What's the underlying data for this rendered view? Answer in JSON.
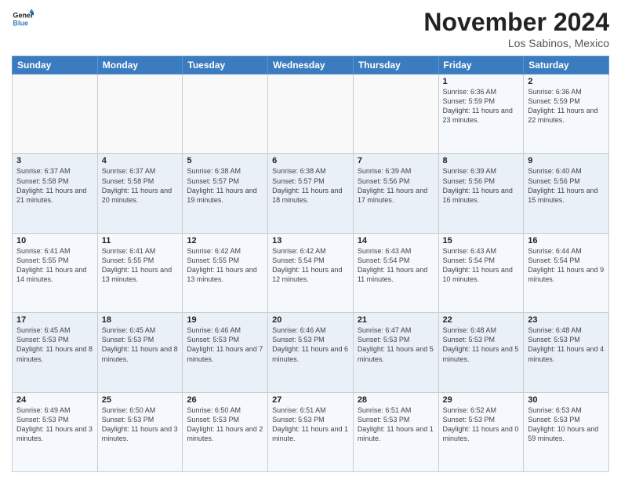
{
  "header": {
    "logo_line1": "General",
    "logo_line2": "Blue",
    "title": "November 2024",
    "location": "Los Sabinos, Mexico"
  },
  "days_of_week": [
    "Sunday",
    "Monday",
    "Tuesday",
    "Wednesday",
    "Thursday",
    "Friday",
    "Saturday"
  ],
  "weeks": [
    [
      {
        "day": "",
        "info": ""
      },
      {
        "day": "",
        "info": ""
      },
      {
        "day": "",
        "info": ""
      },
      {
        "day": "",
        "info": ""
      },
      {
        "day": "",
        "info": ""
      },
      {
        "day": "1",
        "info": "Sunrise: 6:36 AM\nSunset: 5:59 PM\nDaylight: 11 hours and 23 minutes."
      },
      {
        "day": "2",
        "info": "Sunrise: 6:36 AM\nSunset: 5:59 PM\nDaylight: 11 hours and 22 minutes."
      }
    ],
    [
      {
        "day": "3",
        "info": "Sunrise: 6:37 AM\nSunset: 5:58 PM\nDaylight: 11 hours and 21 minutes."
      },
      {
        "day": "4",
        "info": "Sunrise: 6:37 AM\nSunset: 5:58 PM\nDaylight: 11 hours and 20 minutes."
      },
      {
        "day": "5",
        "info": "Sunrise: 6:38 AM\nSunset: 5:57 PM\nDaylight: 11 hours and 19 minutes."
      },
      {
        "day": "6",
        "info": "Sunrise: 6:38 AM\nSunset: 5:57 PM\nDaylight: 11 hours and 18 minutes."
      },
      {
        "day": "7",
        "info": "Sunrise: 6:39 AM\nSunset: 5:56 PM\nDaylight: 11 hours and 17 minutes."
      },
      {
        "day": "8",
        "info": "Sunrise: 6:39 AM\nSunset: 5:56 PM\nDaylight: 11 hours and 16 minutes."
      },
      {
        "day": "9",
        "info": "Sunrise: 6:40 AM\nSunset: 5:56 PM\nDaylight: 11 hours and 15 minutes."
      }
    ],
    [
      {
        "day": "10",
        "info": "Sunrise: 6:41 AM\nSunset: 5:55 PM\nDaylight: 11 hours and 14 minutes."
      },
      {
        "day": "11",
        "info": "Sunrise: 6:41 AM\nSunset: 5:55 PM\nDaylight: 11 hours and 13 minutes."
      },
      {
        "day": "12",
        "info": "Sunrise: 6:42 AM\nSunset: 5:55 PM\nDaylight: 11 hours and 13 minutes."
      },
      {
        "day": "13",
        "info": "Sunrise: 6:42 AM\nSunset: 5:54 PM\nDaylight: 11 hours and 12 minutes."
      },
      {
        "day": "14",
        "info": "Sunrise: 6:43 AM\nSunset: 5:54 PM\nDaylight: 11 hours and 11 minutes."
      },
      {
        "day": "15",
        "info": "Sunrise: 6:43 AM\nSunset: 5:54 PM\nDaylight: 11 hours and 10 minutes."
      },
      {
        "day": "16",
        "info": "Sunrise: 6:44 AM\nSunset: 5:54 PM\nDaylight: 11 hours and 9 minutes."
      }
    ],
    [
      {
        "day": "17",
        "info": "Sunrise: 6:45 AM\nSunset: 5:53 PM\nDaylight: 11 hours and 8 minutes."
      },
      {
        "day": "18",
        "info": "Sunrise: 6:45 AM\nSunset: 5:53 PM\nDaylight: 11 hours and 8 minutes."
      },
      {
        "day": "19",
        "info": "Sunrise: 6:46 AM\nSunset: 5:53 PM\nDaylight: 11 hours and 7 minutes."
      },
      {
        "day": "20",
        "info": "Sunrise: 6:46 AM\nSunset: 5:53 PM\nDaylight: 11 hours and 6 minutes."
      },
      {
        "day": "21",
        "info": "Sunrise: 6:47 AM\nSunset: 5:53 PM\nDaylight: 11 hours and 5 minutes."
      },
      {
        "day": "22",
        "info": "Sunrise: 6:48 AM\nSunset: 5:53 PM\nDaylight: 11 hours and 5 minutes."
      },
      {
        "day": "23",
        "info": "Sunrise: 6:48 AM\nSunset: 5:53 PM\nDaylight: 11 hours and 4 minutes."
      }
    ],
    [
      {
        "day": "24",
        "info": "Sunrise: 6:49 AM\nSunset: 5:53 PM\nDaylight: 11 hours and 3 minutes."
      },
      {
        "day": "25",
        "info": "Sunrise: 6:50 AM\nSunset: 5:53 PM\nDaylight: 11 hours and 3 minutes."
      },
      {
        "day": "26",
        "info": "Sunrise: 6:50 AM\nSunset: 5:53 PM\nDaylight: 11 hours and 2 minutes."
      },
      {
        "day": "27",
        "info": "Sunrise: 6:51 AM\nSunset: 5:53 PM\nDaylight: 11 hours and 1 minute."
      },
      {
        "day": "28",
        "info": "Sunrise: 6:51 AM\nSunset: 5:53 PM\nDaylight: 11 hours and 1 minute."
      },
      {
        "day": "29",
        "info": "Sunrise: 6:52 AM\nSunset: 5:53 PM\nDaylight: 11 hours and 0 minutes."
      },
      {
        "day": "30",
        "info": "Sunrise: 6:53 AM\nSunset: 5:53 PM\nDaylight: 10 hours and 59 minutes."
      }
    ]
  ]
}
